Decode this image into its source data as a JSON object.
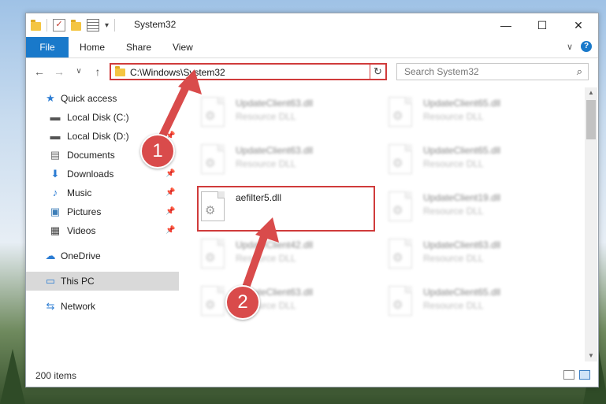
{
  "window": {
    "title": "System32",
    "controls": {
      "minimize": "—",
      "maximize": "☐",
      "close": "✕"
    }
  },
  "ribbon": {
    "file_tab": "File",
    "tabs": [
      "Home",
      "Share",
      "View"
    ],
    "help": "?",
    "expand": "∨"
  },
  "navigation": {
    "back": "←",
    "forward": "→",
    "recent": "∨",
    "up": "↑",
    "address_path": "C:\\Windows\\System32",
    "address_dropdown": "∨",
    "refresh": "↻",
    "search_placeholder": "Search System32",
    "search_icon": "⌕"
  },
  "sidebar": {
    "items": [
      {
        "label": "Quick access",
        "icon": "star-icon",
        "glyph": "★",
        "color": "#2b7cd3",
        "pinned": false
      },
      {
        "label": "Local Disk (C:)",
        "icon": "drive-icon",
        "glyph": "▬",
        "color": "#555555",
        "pinned": false
      },
      {
        "label": "Local Disk (D:)",
        "icon": "drive-icon",
        "glyph": "▬",
        "color": "#555555",
        "pinned": true
      },
      {
        "label": "Documents",
        "icon": "documents-icon",
        "glyph": "▤",
        "color": "#6a6a6a",
        "pinned": true
      },
      {
        "label": "Downloads",
        "icon": "download-icon",
        "glyph": "⬇",
        "color": "#2b7cd3",
        "pinned": true
      },
      {
        "label": "Music",
        "icon": "music-icon",
        "glyph": "♪",
        "color": "#2b7cd3",
        "pinned": true
      },
      {
        "label": "Pictures",
        "icon": "pictures-icon",
        "glyph": "▣",
        "color": "#3d7eb8",
        "pinned": true
      },
      {
        "label": "Videos",
        "icon": "videos-icon",
        "glyph": "▦",
        "color": "#444444",
        "pinned": true
      },
      {
        "label": "OneDrive",
        "icon": "cloud-icon",
        "glyph": "☁",
        "color": "#2b7cd3",
        "pinned": false
      },
      {
        "label": "This PC",
        "icon": "computer-icon",
        "glyph": "▭",
        "color": "#2b7cd3",
        "pinned": false,
        "selected": true
      },
      {
        "label": "Network",
        "icon": "network-icon",
        "glyph": "⇆",
        "color": "#2b7cd3",
        "pinned": false
      }
    ],
    "pin_glyph": "📌"
  },
  "files": {
    "highlighted": {
      "name": "aefilter5.dll"
    },
    "blurred": [
      {
        "name": "UpdateClient63.dll",
        "type": "Resource DLL"
      },
      {
        "name": "UpdateClient65.dll",
        "type": "Resource DLL"
      },
      {
        "name": "UpdateClient63.dll",
        "type": "Resource DLL"
      },
      {
        "name": "UpdateClient65.dll",
        "type": "Resource DLL"
      },
      {
        "name": "UpdateClient19.dll",
        "type": "Resource DLL"
      },
      {
        "name": "UpdateClient42.dll",
        "type": "Resource DLL"
      },
      {
        "name": "UpdateClient63.dll",
        "type": "Resource DLL"
      },
      {
        "name": "UpdateClient63.dll",
        "type": "Resource DLL"
      },
      {
        "name": "UpdateClient65.dll",
        "type": "Resource DLL"
      }
    ]
  },
  "status": {
    "item_count": "200 items"
  },
  "annotations": {
    "step1": "1",
    "step2": "2",
    "color": "#d94b4b"
  }
}
